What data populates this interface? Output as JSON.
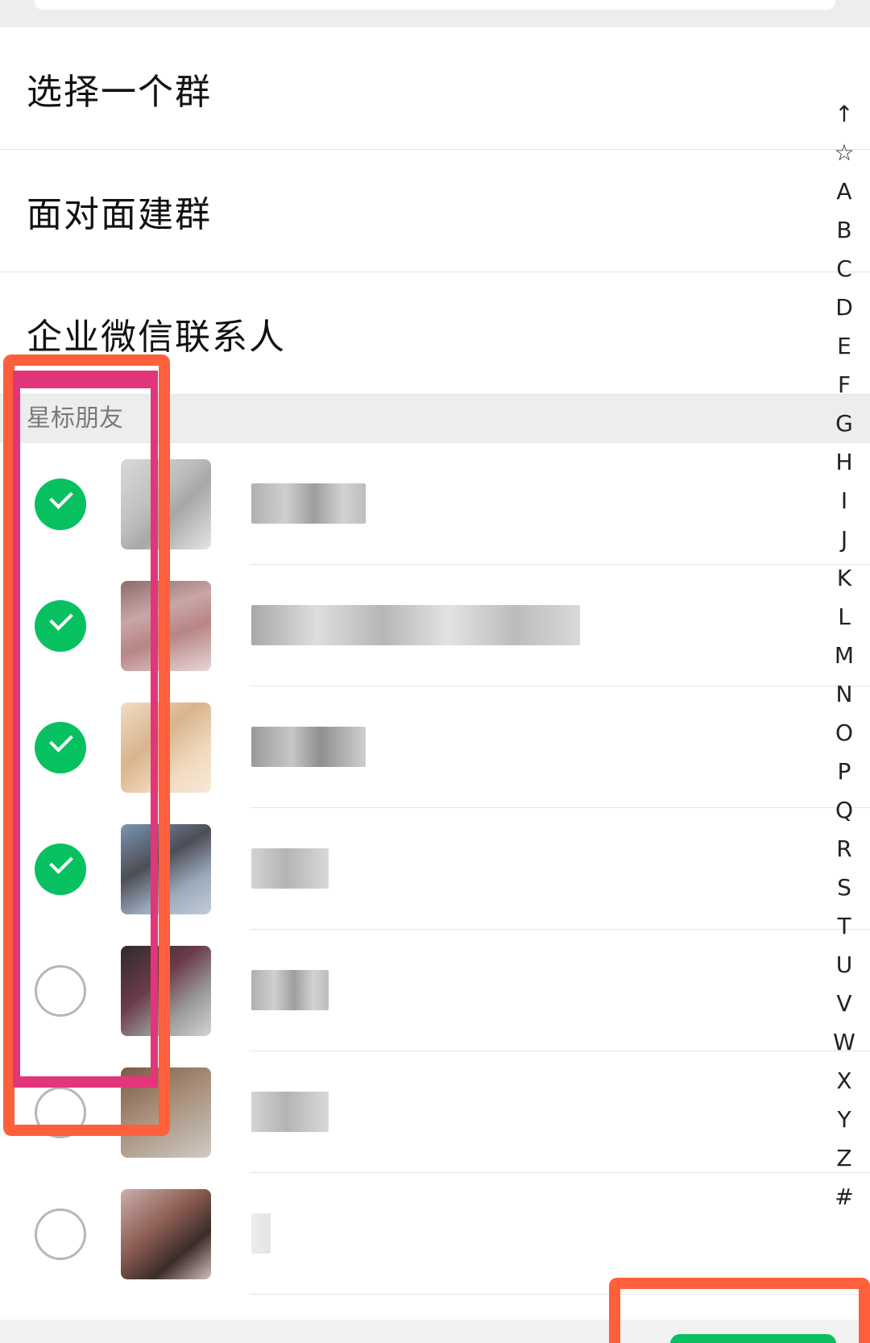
{
  "menu": {
    "select_group": "选择一个群",
    "face_to_face": "面对面建群",
    "work_contacts": "企业微信联系人"
  },
  "section": {
    "starred_title": "星标朋友"
  },
  "contacts": [
    {
      "checked": true
    },
    {
      "checked": true
    },
    {
      "checked": true
    },
    {
      "checked": true
    },
    {
      "checked": false
    },
    {
      "checked": false
    },
    {
      "checked": false
    }
  ],
  "index_letters": [
    "↑",
    "☆",
    "A",
    "B",
    "C",
    "D",
    "E",
    "F",
    "G",
    "H",
    "I",
    "J",
    "K",
    "L",
    "M",
    "N",
    "O",
    "P",
    "Q",
    "R",
    "S",
    "T",
    "U",
    "V",
    "W",
    "X",
    "Y",
    "Z",
    "#"
  ],
  "colors": {
    "accent_green": "#07c160",
    "highlight_orange": "#ff5f3b",
    "highlight_pink": "#e2357a"
  }
}
